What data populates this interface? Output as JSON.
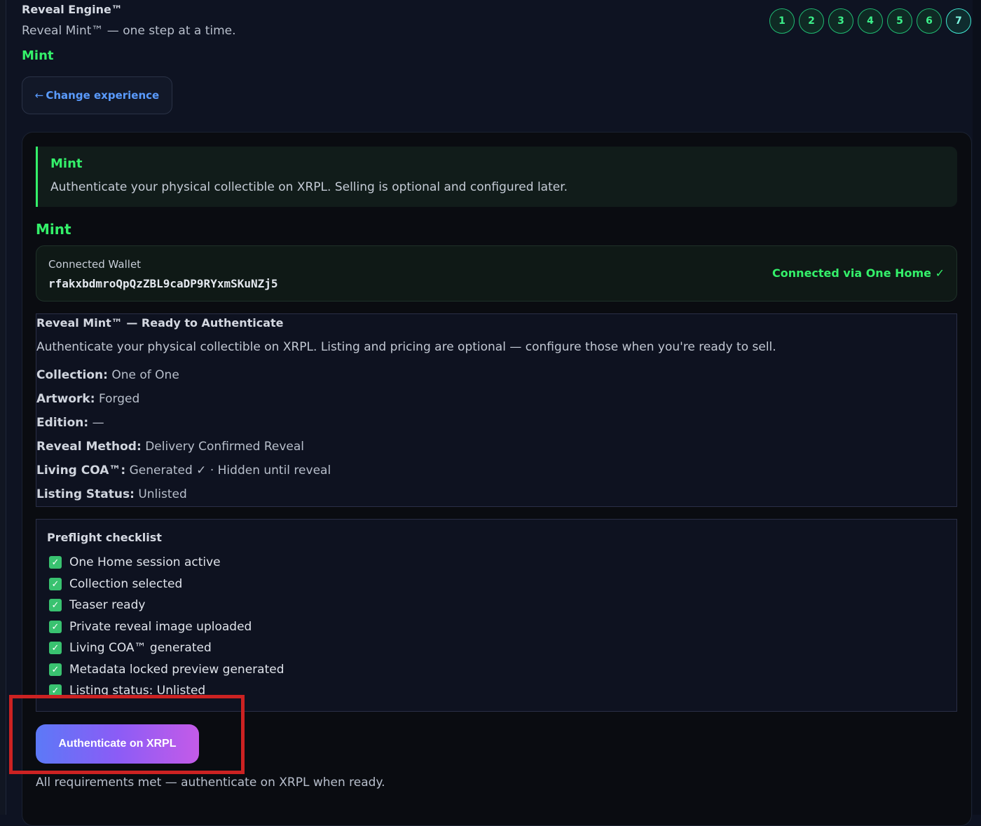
{
  "header": {
    "app_title": "Reveal Engine™",
    "subtitle": "Reveal Mint™ — one step at a time.",
    "experience_label": "Mint",
    "change_button": {
      "arrow": "←",
      "label": "Change experience"
    }
  },
  "steps": [
    "1",
    "2",
    "3",
    "4",
    "5",
    "6",
    "7"
  ],
  "active_step": "7",
  "info_banner": {
    "title": "Mint",
    "text": "Authenticate your physical collectible on XRPL. Selling is optional and configured later."
  },
  "section_title": "Mint",
  "wallet": {
    "label": "Connected Wallet",
    "address": "rfakxbdmroQpQzZBL9caDP9RYxmSKuNZj5",
    "status": "Connected via One Home ✓"
  },
  "summary": {
    "title": "Reveal Mint™ — Ready to Authenticate",
    "text": "Authenticate your physical collectible on XRPL. Listing and pricing are optional — configure those when you're ready to sell.",
    "fields": [
      {
        "key": "Collection:",
        "value": "One of One"
      },
      {
        "key": "Artwork:",
        "value": "Forged"
      },
      {
        "key": "Edition:",
        "value": "—"
      },
      {
        "key": "Reveal Method:",
        "value": "Delivery Confirmed Reveal"
      },
      {
        "key": "Living COA™:",
        "value": "Generated ✓ · Hidden until reveal"
      },
      {
        "key": "Listing Status:",
        "value": "Unlisted"
      }
    ]
  },
  "checklist": {
    "title": "Preflight checklist",
    "items": [
      "One Home session active",
      "Collection selected",
      "Teaser ready",
      "Private reveal image uploaded",
      "Living COA™ generated",
      "Metadata locked preview generated",
      "Listing status: Unlisted"
    ]
  },
  "authenticate_button": "Authenticate on XRPL",
  "footer_status": "All requirements met — authenticate on XRPL when ready.",
  "colors": {
    "accent_green": "#34f06a",
    "link_blue": "#5a9bff",
    "highlight_red": "#cc2222",
    "button_gradient_start": "#5c79f7",
    "button_gradient_end": "#c45be8"
  }
}
